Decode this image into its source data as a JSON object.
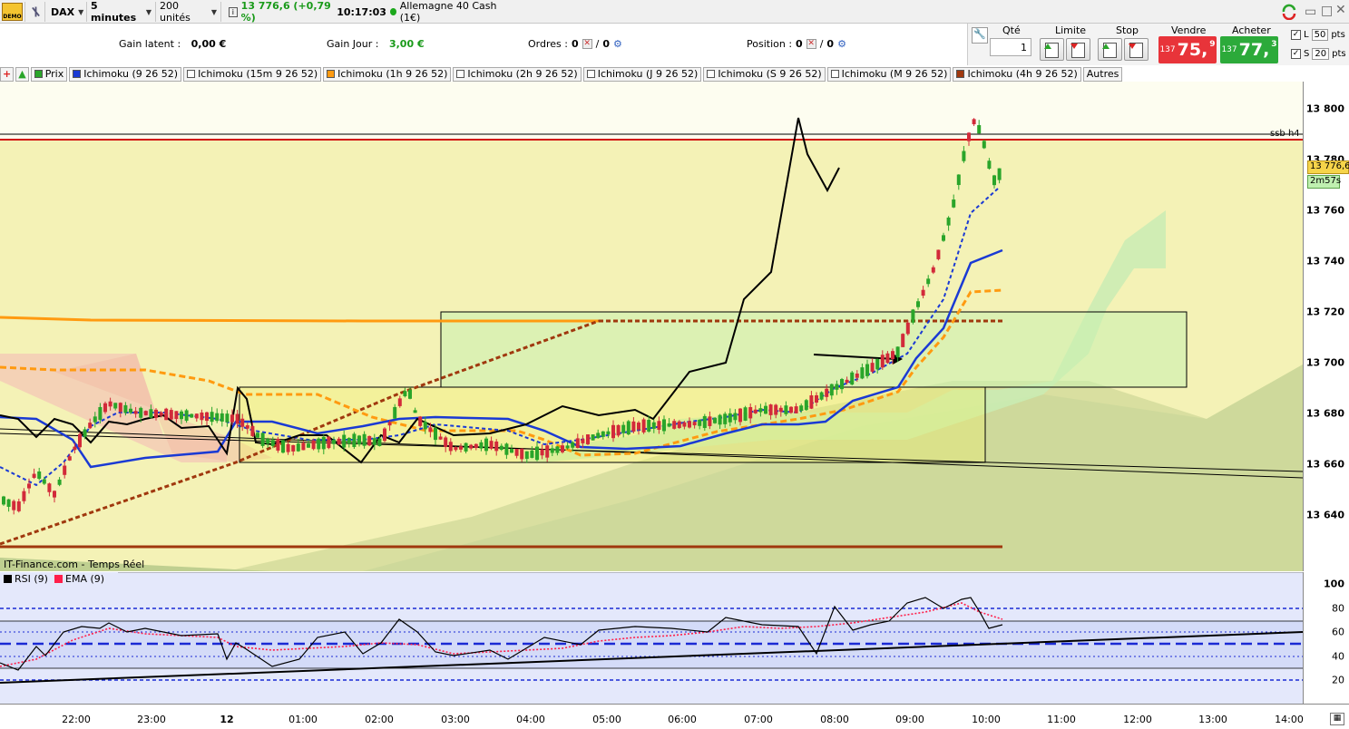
{
  "toolbar": {
    "demo_badge": "DEMO",
    "instrument": "DAX",
    "timeframe": "5 minutes",
    "units": "200 unités",
    "quote": "13 776,6 (+0,79 %)",
    "time": "10:17:03",
    "market": "Allemagne 40 Cash (1€)"
  },
  "infobar": {
    "gain_latent_label": "Gain latent :",
    "gain_latent_value": "0,00 €",
    "gain_jour_label": "Gain Jour :",
    "gain_jour_value": "3,00 €",
    "ordres_label": "Ordres :",
    "ordres_a": "0",
    "ordres_b": "0",
    "position_label": "Position :",
    "position_a": "0",
    "position_b": "0"
  },
  "order_panel": {
    "qty_label": "Qté",
    "qty_value": "1",
    "limit_label": "Limite",
    "stop_label": "Stop",
    "sell_label": "Vendre",
    "sell_small": "137",
    "sell_big": "75,",
    "sell_sup": "9",
    "buy_label": "Acheter",
    "buy_small": "137",
    "buy_big": "77,",
    "buy_sup": "3",
    "l_label": "L",
    "l_value": "50",
    "s_label": "S",
    "s_value": "20",
    "pts": "pts",
    "colors": {
      "sell": "#e8343a",
      "buy": "#2caa3a"
    }
  },
  "indicators": [
    {
      "label": "Prix",
      "color": "#2aa52a"
    },
    {
      "label": "Ichimoku (9 26 52)",
      "color": "#1a3ad4"
    },
    {
      "label": "Ichimoku (15m 9 26 52)",
      "color": "#ffffff"
    },
    {
      "label": "Ichimoku (1h 9 26 52)",
      "color": "#ff9a10"
    },
    {
      "label": "Ichimoku (2h 9 26 52)",
      "color": "#ffffff"
    },
    {
      "label": "Ichimoku (J 9 26 52)",
      "color": "#ffffff"
    },
    {
      "label": "Ichimoku (S 9 26 52)",
      "color": "#ffffff"
    },
    {
      "label": "Ichimoku (M 9 26 52)",
      "color": "#ffffff"
    },
    {
      "label": "Ichimoku (4h 9 26 52)",
      "color": "#a0380e"
    },
    {
      "label": "Autres",
      "color": ""
    }
  ],
  "chart": {
    "source_label": "IT-Finance.com - Temps Réel",
    "level_label": "ssb h4",
    "current_price": "13 776,6",
    "countdown": "2m57s",
    "price_ticks": [
      "13 800",
      "13 780",
      "13 760",
      "13 740",
      "13 720",
      "13 700",
      "13 680",
      "13 660",
      "13 640"
    ],
    "time_ticks": [
      "22:00",
      "23:00",
      "12",
      "01:00",
      "02:00",
      "03:00",
      "04:00",
      "05:00",
      "06:00",
      "07:00",
      "08:00",
      "09:00",
      "10:00",
      "11:00",
      "12:00",
      "13:00",
      "14:00"
    ]
  },
  "rsi": {
    "legend": [
      {
        "label": "RSI (9)",
        "color": "#000000"
      },
      {
        "label": "EMA (9)",
        "color": "#ff1f4a"
      }
    ],
    "ticks": [
      "100",
      "80",
      "60",
      "40",
      "20"
    ]
  }
}
